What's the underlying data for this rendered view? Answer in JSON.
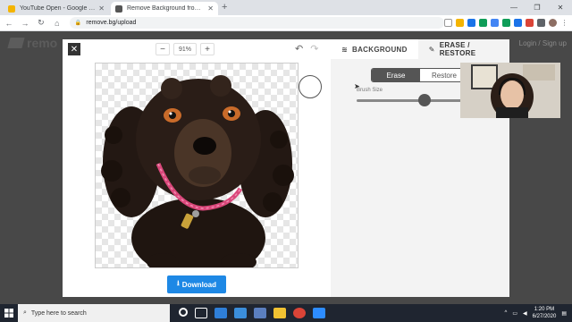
{
  "browser": {
    "tabs": [
      {
        "title": "YouTube Open - Google Slides",
        "favicon_color": "#f4b400",
        "active": false
      },
      {
        "title": "Remove Background from Imag",
        "favicon_color": "#555555",
        "active": true
      }
    ],
    "new_tab": "+",
    "window_controls": {
      "minimize": "—",
      "maximize": "❐",
      "close": "✕"
    },
    "url": "remove.bg/upload",
    "nav": {
      "back": "←",
      "forward": "→",
      "reload": "↻",
      "home": "⌂"
    }
  },
  "site": {
    "logo_text": "remo",
    "header_link": "Login / Sign up"
  },
  "editor": {
    "close": "✕",
    "zoom_out": "−",
    "zoom_value": "91%",
    "zoom_in": "+",
    "undo": "↶",
    "redo": "↷",
    "download_label": "Download",
    "download_icon": "⭳"
  },
  "panel": {
    "tabs": [
      {
        "label": "BACKGROUND",
        "icon": "layers-icon"
      },
      {
        "label": "ERASE / RESTORE",
        "icon": "brush-icon"
      }
    ],
    "modes": {
      "erase": "Erase",
      "restore": "Restore",
      "selected": "Erase"
    },
    "brush_size_label": "Brush Size",
    "brush_size_fraction": 0.63
  },
  "taskbar": {
    "search_placeholder": "Type here to search",
    "time": "1:20 PM",
    "date": "6/27/2020"
  },
  "colors": {
    "accent_blue": "#1e88e5",
    "dark_button": "#555555",
    "dog_fur": "#2a1d17",
    "collar": "#d9477a"
  }
}
